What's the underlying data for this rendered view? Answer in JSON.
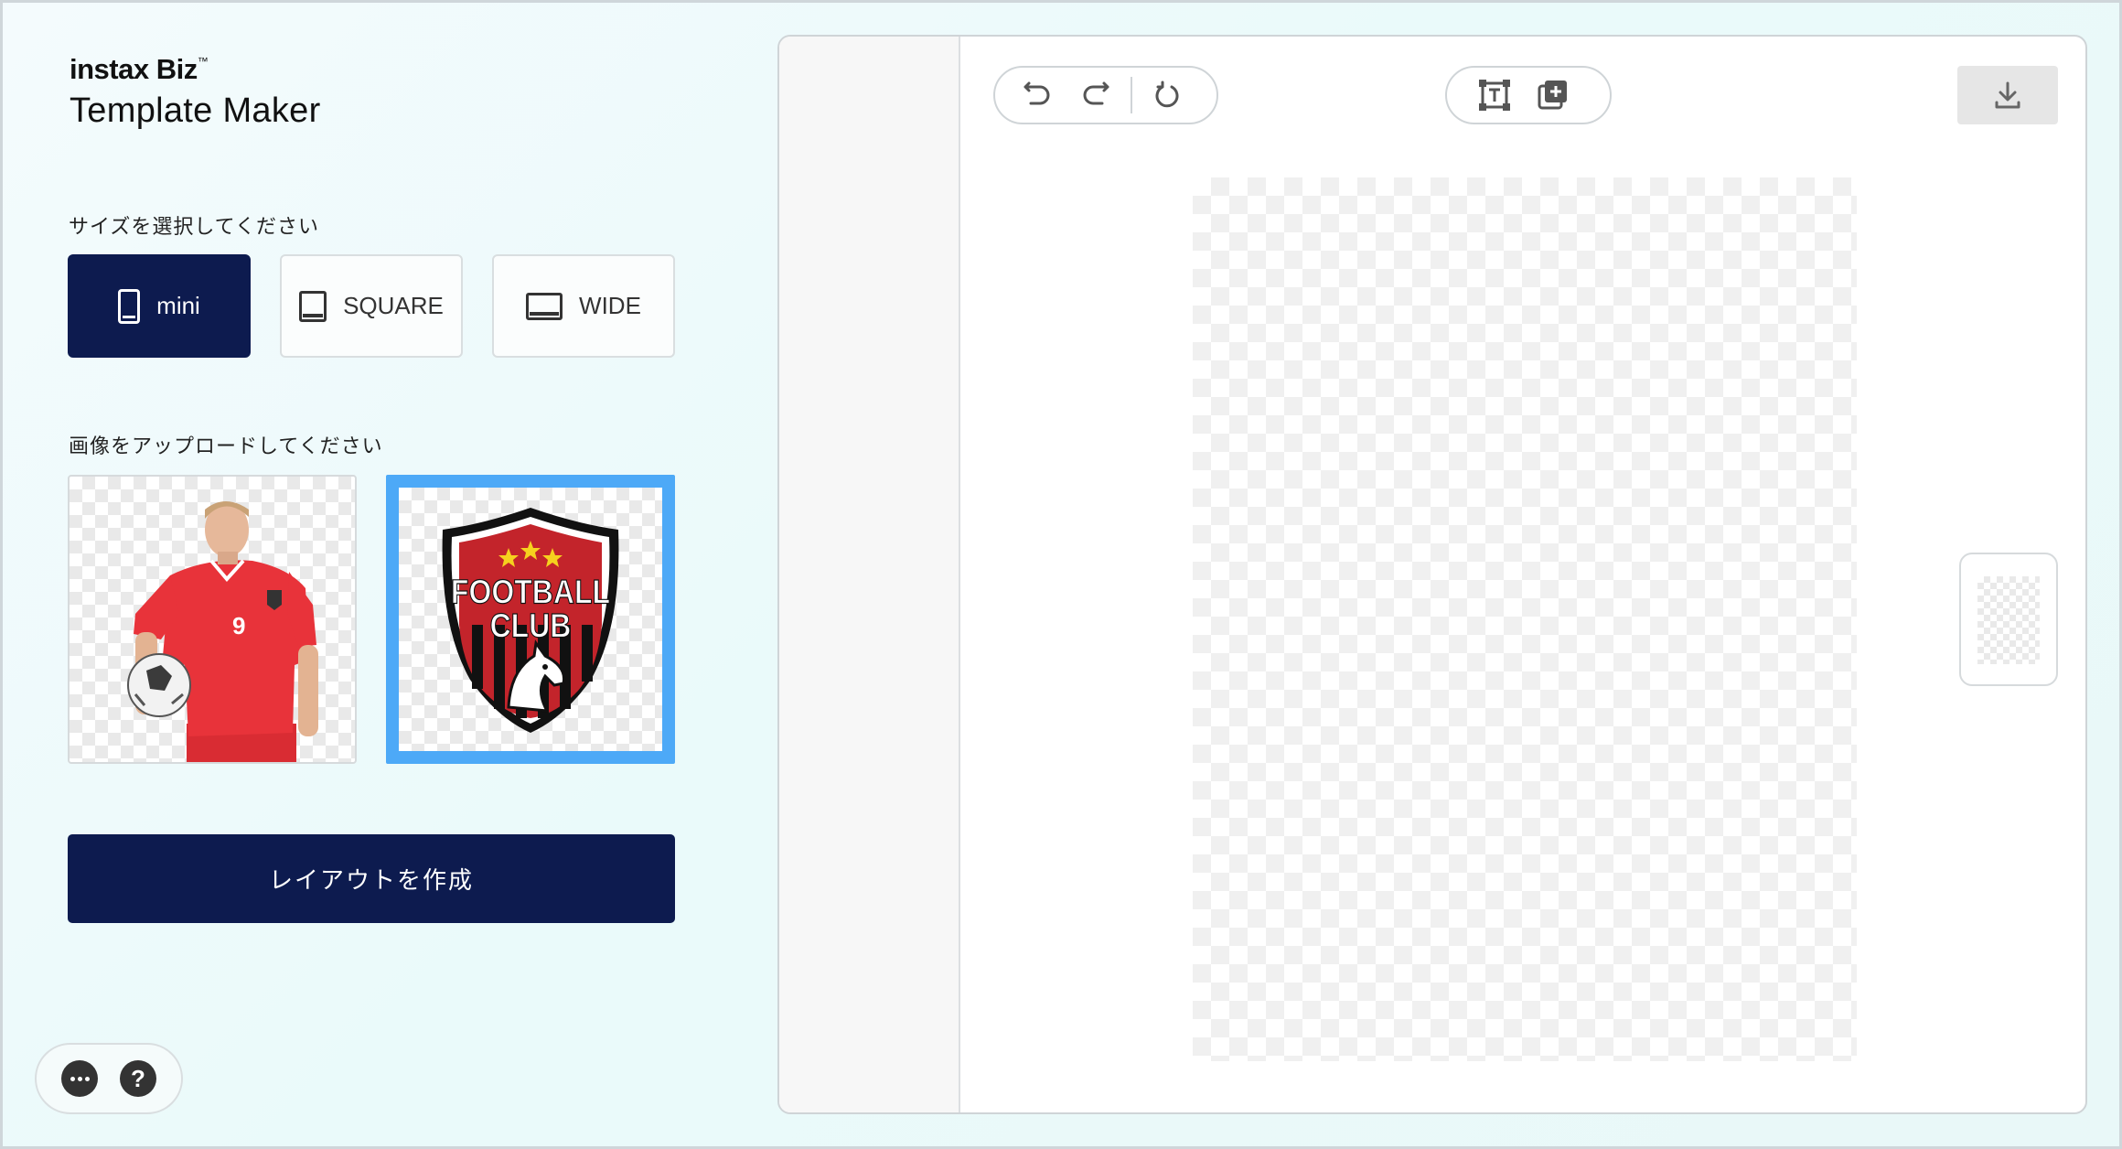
{
  "brand": {
    "name": "instax Biz",
    "tm": "™",
    "title": "Template Maker"
  },
  "size_section": {
    "label": "サイズを選択してください",
    "options": [
      {
        "label": "mini",
        "icon": "portrait-card-icon",
        "selected": true
      },
      {
        "label": "SQUARE",
        "icon": "square-card-icon",
        "selected": false
      },
      {
        "label": "WIDE",
        "icon": "wide-card-icon",
        "selected": false
      }
    ]
  },
  "upload_section": {
    "label": "画像をアップロードしてください",
    "images": [
      {
        "name": "soccer-player-image",
        "selected": false
      },
      {
        "name": "football-club-logo-image",
        "selected": true,
        "logo_text_1": "FOOTBALL",
        "logo_text_2": "CLUB"
      }
    ]
  },
  "create_button": {
    "label": "レイアウトを作成"
  },
  "footer": {
    "menu_icon": "more-icon",
    "help_icon": "help-icon",
    "help_glyph": "?"
  },
  "editor": {
    "toolbar_left": [
      "undo-icon",
      "redo-icon",
      "reset-icon"
    ],
    "toolbar_center": [
      "add-text-icon",
      "add-image-icon"
    ],
    "download_icon": "download-icon"
  },
  "colors": {
    "primary": "#0d1b4f",
    "selection": "#4da9f7",
    "jersey_red": "#e8333a"
  }
}
